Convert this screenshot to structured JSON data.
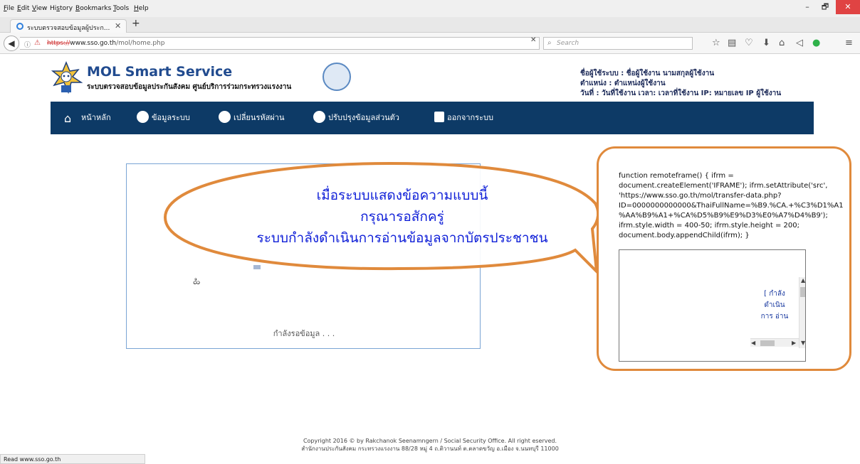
{
  "menubar": {
    "items": [
      {
        "key": "F",
        "rest": "ile"
      },
      {
        "key": "E",
        "rest": "dit"
      },
      {
        "key": "V",
        "rest": "iew"
      },
      {
        "pre": "Hi",
        "key": "s",
        "rest": "tory"
      },
      {
        "key": "B",
        "rest": "ookmarks"
      },
      {
        "key": "T",
        "rest": "ools"
      },
      {
        "key": "H",
        "rest": "elp"
      }
    ]
  },
  "window": {
    "minimize": "–",
    "maximize": "🗗",
    "close": "✕"
  },
  "tab": {
    "title": "ระบบตรวจสอบข้อมูลผู้ประก...",
    "close": "✕",
    "new": "+"
  },
  "address": {
    "scheme": "https://",
    "host": "www.sso.go.th",
    "path": "/mol/home.php",
    "clear": "✕"
  },
  "search": {
    "placeholder": "Search"
  },
  "toolbar_icons": [
    "star-icon",
    "reading-list-icon",
    "pocket-icon",
    "download-icon",
    "home-icon",
    "share-icon",
    "addon-icon",
    "menu-icon"
  ],
  "header": {
    "title": "MOL Smart Service",
    "subtitle": "ระบบตรวจสอบข้อมูลประกันสังคม ศูนย์บริการร่วมกระทรวงแรงงาน",
    "user_line1": "ชื่อผู้ใช้ระบบ : ชื่อผู้ใช้งาน  นามสกุลผู้ใช้งาน",
    "user_line2": "ตำแหน่ง : ตำแหน่งผู้ใช้งาน",
    "user_line3": "วันที่ : วันที่ใช้งาน    เวลา: เวลาที่ใช้งาน   IP: หมายเลข IP ผู้ใช้งาน"
  },
  "nav": {
    "home": "หน้าหลัก",
    "system_info": "ข้อมูลระบบ",
    "change_password": "เปลี่ยนรหัสผ่าน",
    "update_profile": "ปรับปรุงข้อมูลส่วนตัว",
    "logout": "ออกจากระบบ"
  },
  "loading": {
    "text": "กำลังรอข้อมูล . . ."
  },
  "callout": {
    "line1": "เมื่อระบบแสดงข้อความแบบนี้",
    "line2": "กรุณารอสักครู่",
    "line3": "ระบบกำลังดำเนินการอ่านข้อมูลจากบัตรประชาชน"
  },
  "code_note": {
    "code": "function remoteframe() { ifrm = document.createElement('IFRAME'); ifrm.setAttribute('src', 'https://www.sso.go.th/mol/transfer-data.php?ID=0000000000000&ThaiFullName=%B9.%CA.+%C3%D1%A1%AA%B9%A1+%CA%D5%B9%E9%D3%E0%A7%D4%B9'); ifrm.style.width = 400-50; ifrm.style.height = 200; document.body.appendChild(ifrm); }",
    "iframe_text": "[ กำลัง ดำเนิน การ อ่าน"
  },
  "footer": {
    "line1": "Copyright 2016 © by Rakchanok Seenamngern / Social Security Office. All right eserved.",
    "line2": "สำนักงานประกันสังคม กระทรวงแรงงาน 88/28 หมู่ 4 ถ.ติวานนท์ ต.ตลาดขวัญ อ.เมือง จ.นนทบุรี 11000"
  },
  "status": {
    "text": "Read www.sso.go.th"
  },
  "colors": {
    "nav_bg": "#0d3a66",
    "callout_border": "#e08a3c",
    "callout_text": "#1020d8",
    "title": "#214b8f"
  }
}
